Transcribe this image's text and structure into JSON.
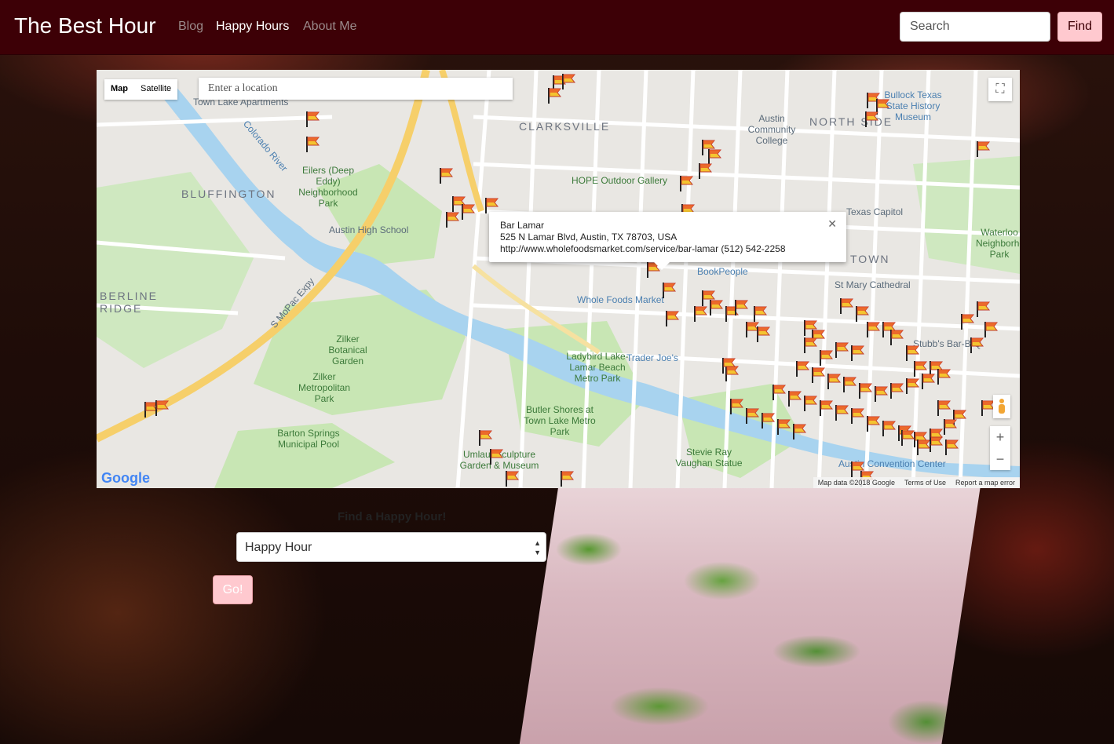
{
  "navbar": {
    "brand": "The Best Hour",
    "links": [
      "Blog",
      "Happy Hours",
      "About Me"
    ],
    "active_link": "Happy Hours",
    "search_placeholder": "Search",
    "find_label": "Find"
  },
  "map": {
    "map_type_options": [
      "Map",
      "Satellite"
    ],
    "selected_map_type": "Map",
    "location_placeholder": "Enter a location",
    "logo": "Google",
    "footer": [
      "Map data ©2018 Google",
      "Terms of Use",
      "Report a map error"
    ],
    "labels": {
      "clarksville": "CLARKSVILLE",
      "bluffington": "BLUFFINGTON",
      "northside": "NORTH SIDE",
      "downtown": "TOWN",
      "berline": "BERLINE",
      "ridge": "RIDGE",
      "town_lake": "Town Lake Apartments",
      "eilers": "Eilers (Deep Eddy) Neighborhood Park",
      "austin_high": "Austin High School",
      "hope": "HOPE Outdoor Gallery",
      "acc": "Austin Community College",
      "texas_capitol": "Texas Capitol",
      "whole_foods": "Whole Foods Market",
      "bookpeople": "BookPeople",
      "zilker_garden": "Zilker Botanical Garden",
      "zilker_park": "Zilker Metropolitan Park",
      "barton_springs": "Barton Springs Municipal Pool",
      "umlauf": "Umlauf Sculpture Garden & Museum",
      "butler": "Butler Shores at Town Lake Metro Park",
      "lady_bird": "Ladybird Lake-Lamar Beach Metro Park",
      "stevie_ray": "Stevie Ray Vaughan Statue",
      "convention": "Austin Convention Center",
      "st_mary": "St Mary Cathedral",
      "stubbs": "Stubb's Bar-B-Q",
      "trader_joes": "Trader Joe's",
      "bullock": "Bullock Texas State History Museum",
      "waterloo": "Waterloo Neighborhood Park",
      "colorado_river": "Colorado River",
      "mopac": "S MoPac Expy"
    },
    "info_window": {
      "name": "Bar Lamar",
      "address": "525 N Lamar Blvd, Austin, TX 78703, USA",
      "details": "http://www.wholefoodsmarket.com/service/bar-lamar (512) 542-2258"
    },
    "marker_icon": "flag-icon"
  },
  "form": {
    "heading": "Find a Happy Hour!",
    "select_value": "Happy Hour",
    "go_label": "Go!"
  }
}
